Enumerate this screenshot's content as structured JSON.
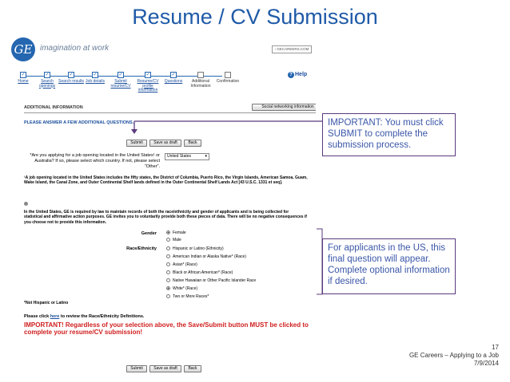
{
  "slide": {
    "title": "Resume / CV Submission",
    "page_number": "17",
    "footer_title": "GE Careers – Applying to a Job",
    "footer_date": "7/9/2014"
  },
  "colors": {
    "title": "#1f5aa8",
    "callout_text": "#3a56a8",
    "callout_border": "#5a3a7e",
    "warning": "#d01e1e",
    "brand": "#2466b0"
  },
  "site": {
    "logo_text": "GE",
    "tagline": "imagination at work",
    "link_label": "› GECAREERS.COM",
    "help_label": "Help",
    "steps": [
      {
        "label": "Home"
      },
      {
        "label": "Search openings"
      },
      {
        "label": "Search results"
      },
      {
        "label": "Job details"
      },
      {
        "label": "Submit resume/CV"
      },
      {
        "label": "Resume/CV profile information"
      },
      {
        "label": "Questions"
      },
      {
        "label": "Additional Information"
      },
      {
        "label": "Confirmation"
      }
    ]
  },
  "form": {
    "section_title": "ADDITIONAL INFORMATION",
    "social_button": "Social networking information",
    "prompt": "PLEASE ANSWER A FEW ADDITIONAL QUESTIONS.",
    "buttons": {
      "submit": "Submit",
      "save_draft": "Save as draft",
      "back": "Back"
    },
    "q1_label": "*Are you applying for a job opening located in the United States¹ or Australia? If so, please select which country. If not, please select \"Other\".",
    "q1_value": "United States",
    "footnote": "¹A job opening located in the United States includes the fifty states, the District of Columbia, Puerto Rico, the Virgin Islands, American Samoa, Guam, Wake Island, the Canal Zone, and Outer Continental Shelf lands defined in the Outer Continental Shelf Lands Act [43 U.S.C. 1331 et seq].",
    "eeo_text": "In the United States, GE is required by law to maintain records of both the race/ethnicity and gender of applicants and is being collected for statistical and affirmative action purposes. GE invites you to voluntarily provide both these pieces of data. There will be no negative consequences if you choose not to provide this information.",
    "gender_label": "Gender",
    "gender_options": [
      "Female",
      "Male"
    ],
    "race_label": "Race/Ethnicity",
    "race_options": [
      "Hispanic or Latino (Ethnicity)",
      "American Indian or Alaska Native* (Race)",
      "Asian* (Race)",
      "Black or African American* (Race)",
      "Native Hawaiian or Other Pacific Islander Race",
      "White* (Race)",
      "Two or More Races*"
    ],
    "not_hispanic_note": "*Not Hispanic or Latino",
    "review_prefix": "Please click ",
    "review_link": "here",
    "review_suffix": " to review the Race/Ethnicity Definitions.",
    "warning": "IMPORTANT! Regardless of your selection above, the Save/Submit button MUST be clicked to complete your resume/CV submission!"
  },
  "callouts": {
    "submit_note": "IMPORTANT: You must click SUBMIT to complete the submission process.",
    "optional_note": "For applicants in the US, this final question will appear. Complete optional information if desired."
  }
}
